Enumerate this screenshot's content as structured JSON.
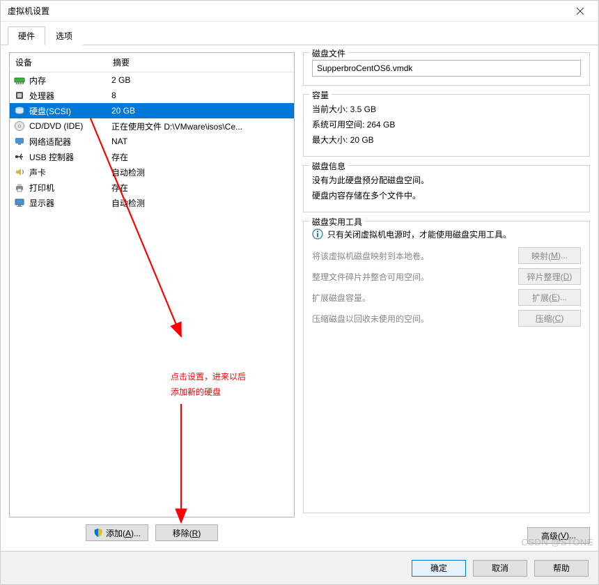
{
  "window": {
    "title": "虚拟机设置"
  },
  "tabs": {
    "hardware": "硬件",
    "options": "选项"
  },
  "list": {
    "col_device": "设备",
    "col_summary": "摘要",
    "rows": [
      {
        "icon": "memory",
        "label": "内存",
        "summary": "2 GB"
      },
      {
        "icon": "cpu",
        "label": "处理器",
        "summary": "8"
      },
      {
        "icon": "disk",
        "label": "硬盘(SCSI)",
        "summary": "20 GB",
        "selected": true
      },
      {
        "icon": "cd",
        "label": "CD/DVD (IDE)",
        "summary": "正在使用文件 D:\\VMware\\isos\\Ce..."
      },
      {
        "icon": "net",
        "label": "网络适配器",
        "summary": "NAT"
      },
      {
        "icon": "usb",
        "label": "USB 控制器",
        "summary": "存在"
      },
      {
        "icon": "sound",
        "label": "声卡",
        "summary": "自动检测"
      },
      {
        "icon": "printer",
        "label": "打印机",
        "summary": "存在"
      },
      {
        "icon": "display",
        "label": "显示器",
        "summary": "自动检测"
      }
    ]
  },
  "left_buttons": {
    "add": "添加(A)...",
    "remove": "移除(R)"
  },
  "disk_file": {
    "title": "磁盘文件",
    "value": "SupperbroCentOS6.vmdk"
  },
  "capacity": {
    "title": "容量",
    "current": "当前大小: 3.5 GB",
    "sys_free": "系统可用空间: 264 GB",
    "max": "最大大小: 20 GB"
  },
  "disk_info": {
    "title": "磁盘信息",
    "line1": "没有为此硬盘预分配磁盘空间。",
    "line2": "硬盘内容存储在多个文件中。"
  },
  "disk_util": {
    "title": "磁盘实用工具",
    "notice": "只有关闭虚拟机电源时，才能使用磁盘实用工具。",
    "map_desc": "将该虚拟机磁盘映射到本地卷。",
    "map_btn": "映射(M)...",
    "defrag_desc": "整理文件碎片并整合可用空间。",
    "defrag_btn": "碎片整理(D)",
    "expand_desc": "扩展磁盘容量。",
    "expand_btn": "扩展(E)...",
    "compact_desc": "压缩磁盘以回收未使用的空间。",
    "compact_btn": "压缩(C)"
  },
  "advanced_btn": "高级(V)...",
  "bottom": {
    "ok": "确定",
    "cancel": "取消",
    "help": "帮助"
  },
  "annotation": {
    "line1": "点击设置，进来以后",
    "line2": "添加新的硬盘"
  },
  "watermark": "CSDN @STONE"
}
